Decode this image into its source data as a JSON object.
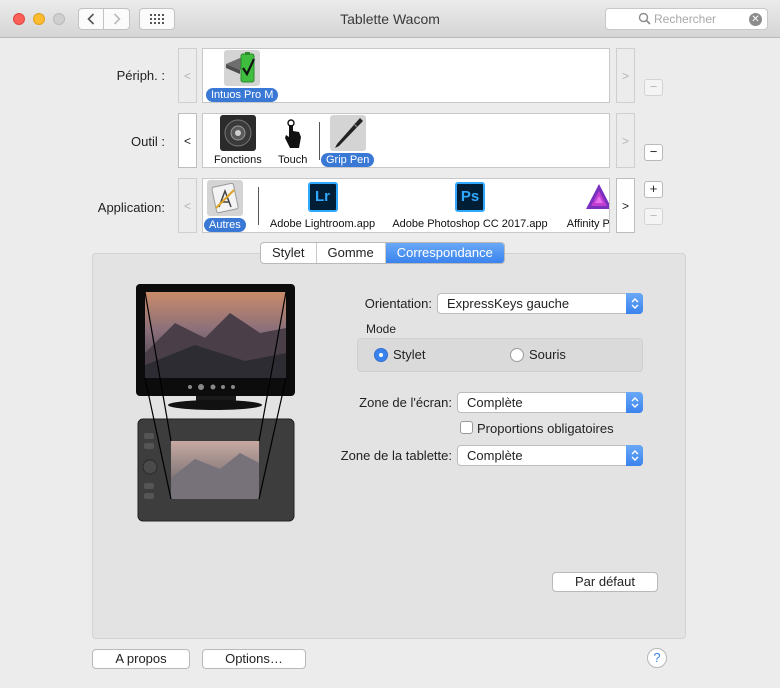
{
  "window": {
    "title": "Tablette Wacom"
  },
  "search": {
    "placeholder": "Rechercher"
  },
  "rows": {
    "periph": {
      "label": "Périph. :",
      "items": [
        {
          "label": "Intuos Pro M"
        }
      ]
    },
    "outil": {
      "label": "Outil :",
      "items": [
        {
          "label": "Fonctions"
        },
        {
          "label": "Touch"
        },
        {
          "label": "Grip Pen"
        }
      ]
    },
    "application": {
      "label": "Application:",
      "items": [
        {
          "label": "Autres"
        },
        {
          "label": "Adobe Lightroom.app",
          "icon_text": "Lr"
        },
        {
          "label": "Adobe Photoshop CC 2017.app",
          "icon_text": "Ps"
        },
        {
          "label": "Affinity Photo"
        }
      ]
    }
  },
  "arrows": {
    "left": "<",
    "right": ">"
  },
  "buttons": {
    "plus": "+",
    "minus": "−"
  },
  "tabs": [
    {
      "label": "Stylet"
    },
    {
      "label": "Gomme"
    },
    {
      "label": "Correspondance",
      "selected": true
    }
  ],
  "mapping": {
    "orientation_label": "Orientation:",
    "orientation_value": "ExpressKeys gauche",
    "mode_label": "Mode",
    "mode_options": [
      {
        "label": "Stylet",
        "selected": true
      },
      {
        "label": "Souris",
        "selected": false
      }
    ],
    "screen_zone_label": "Zone de l'écran:",
    "screen_zone_value": "Complète",
    "force_proportions_label": "Proportions obligatoires",
    "tablet_zone_label": "Zone de la tablette:",
    "tablet_zone_value": "Complète",
    "default_button": "Par défaut"
  },
  "footer": {
    "about_button": "A propos",
    "options_button": "Options…",
    "help_icon": "?"
  },
  "colors": {
    "accent": "#3a83ee",
    "selected_label": "#3a78d6",
    "lightroom": "#31a8ff",
    "photoshop": "#31a8ff"
  }
}
